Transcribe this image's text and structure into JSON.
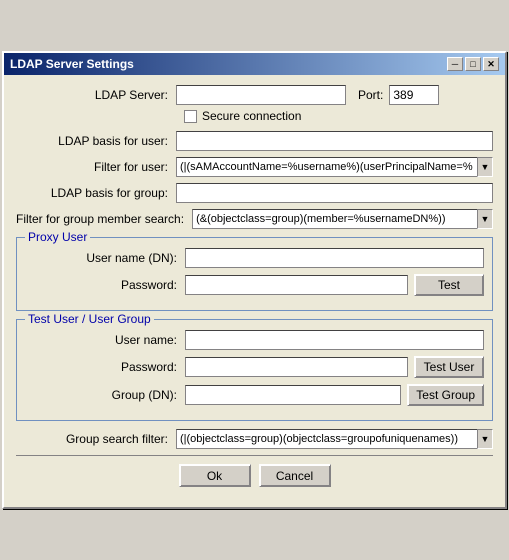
{
  "window": {
    "title": "LDAP Server Settings",
    "close_btn": "✕",
    "minimize_btn": "─",
    "maximize_btn": "□"
  },
  "form": {
    "ldap_server_label": "LDAP Server:",
    "ldap_server_value": "",
    "port_label": "Port:",
    "port_value": "389",
    "secure_connection_label": "Secure connection",
    "ldap_basis_user_label": "LDAP basis for user:",
    "ldap_basis_user_value": "",
    "filter_user_label": "Filter for user:",
    "filter_user_value": "(|(sAMAccountName=%username%)(userPrincipalName=%",
    "ldap_basis_group_label": "LDAP basis for group:",
    "ldap_basis_group_value": "",
    "filter_group_label": "Filter for group member search:",
    "filter_group_value": "(&(objectclass=group)(member=%usernameDN%))",
    "proxy_user_section": "Proxy User",
    "username_dn_label": "User name (DN):",
    "username_dn_value": "",
    "password_label": "Password:",
    "password_value": "",
    "test_btn": "Test",
    "test_user_section": "Test User / User Group",
    "test_username_label": "User name:",
    "test_username_value": "",
    "test_password_label": "Password:",
    "test_password_value": "",
    "test_group_dn_label": "Group (DN):",
    "test_group_dn_value": "",
    "test_user_btn": "Test User",
    "test_group_btn": "Test Group",
    "group_search_filter_label": "Group search filter:",
    "group_search_filter_value": "(|(objectclass=group)(objectclass=groupofuniquenames))",
    "ok_btn": "Ok",
    "cancel_btn": "Cancel"
  }
}
